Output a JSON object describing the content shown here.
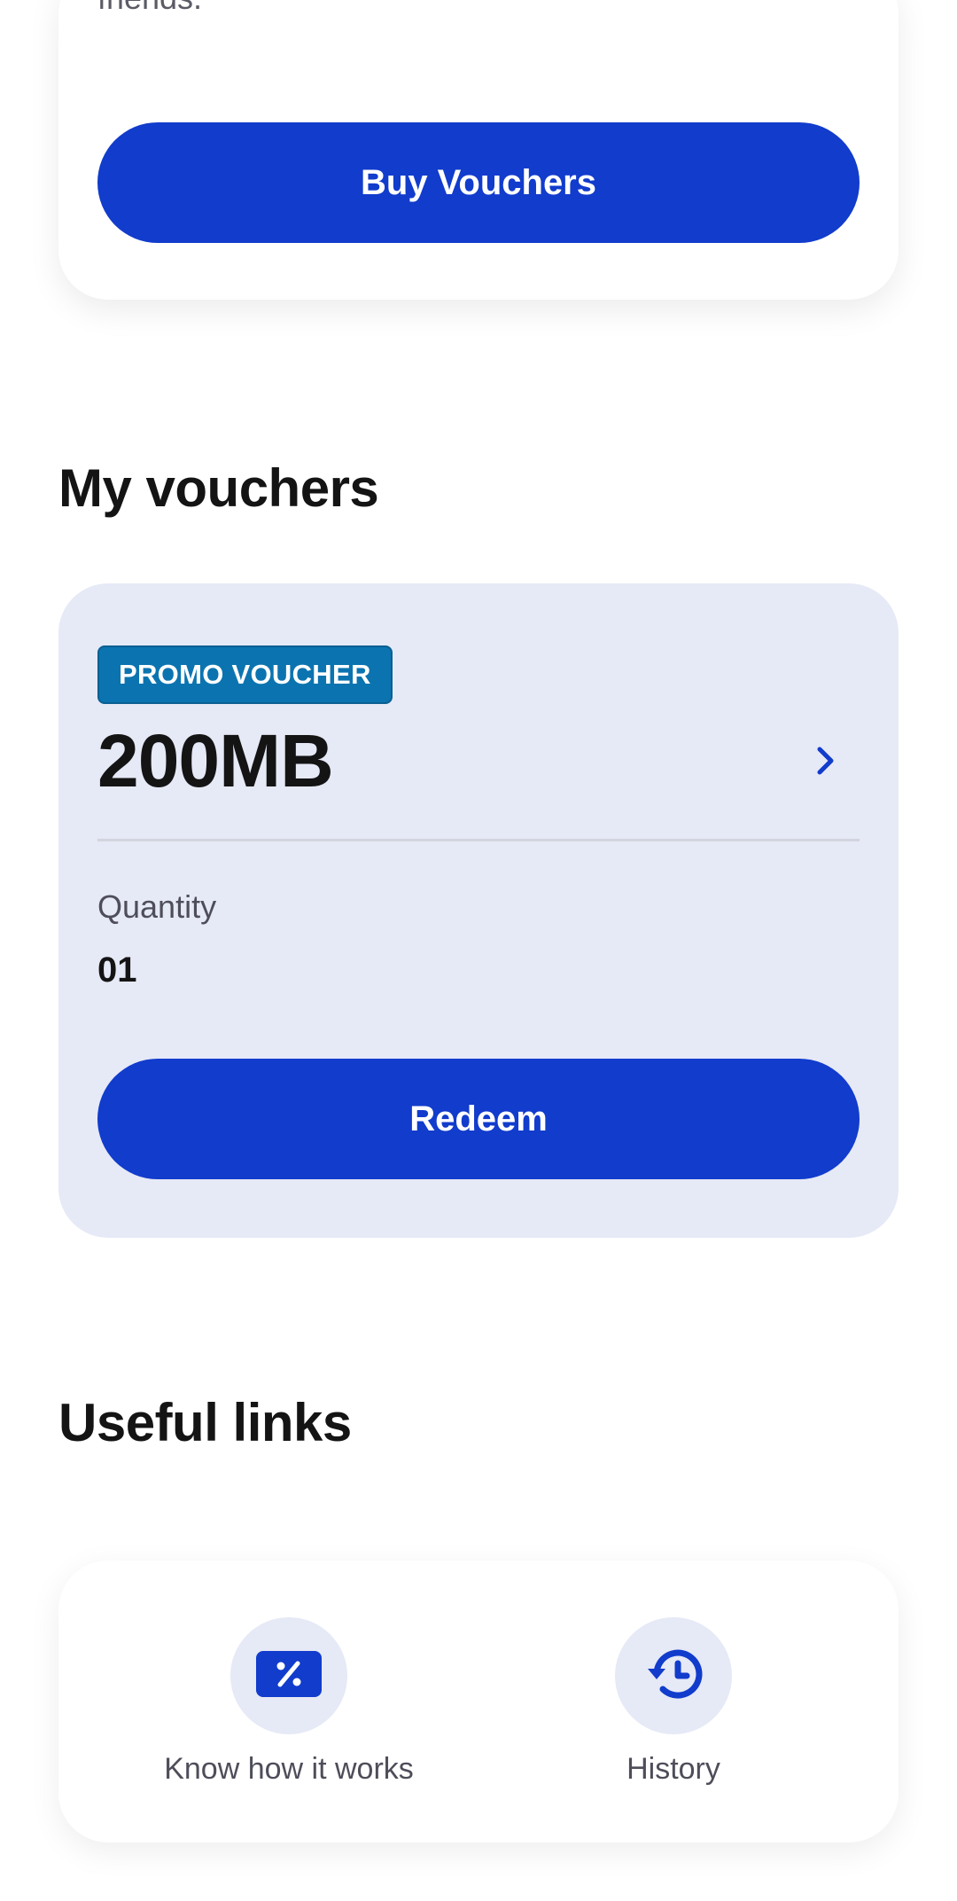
{
  "top_card": {
    "description_partial": "friends.",
    "button_label": "Buy Vouchers"
  },
  "my_vouchers": {
    "title": "My vouchers",
    "vouchers": [
      {
        "badge": "PROMO VOUCHER",
        "amount": "200MB",
        "quantity_label": "Quantity",
        "quantity_value": "01",
        "button_label": "Redeem"
      }
    ]
  },
  "useful_links": {
    "title": "Useful links",
    "items": [
      {
        "label": "Know how it works",
        "icon": "discount-ticket-icon"
      },
      {
        "label": "History",
        "icon": "history-clock-icon"
      }
    ]
  },
  "colors": {
    "primary": "#113ccc",
    "badge": "#0b74b0",
    "card_tint": "#e6e9f6"
  }
}
